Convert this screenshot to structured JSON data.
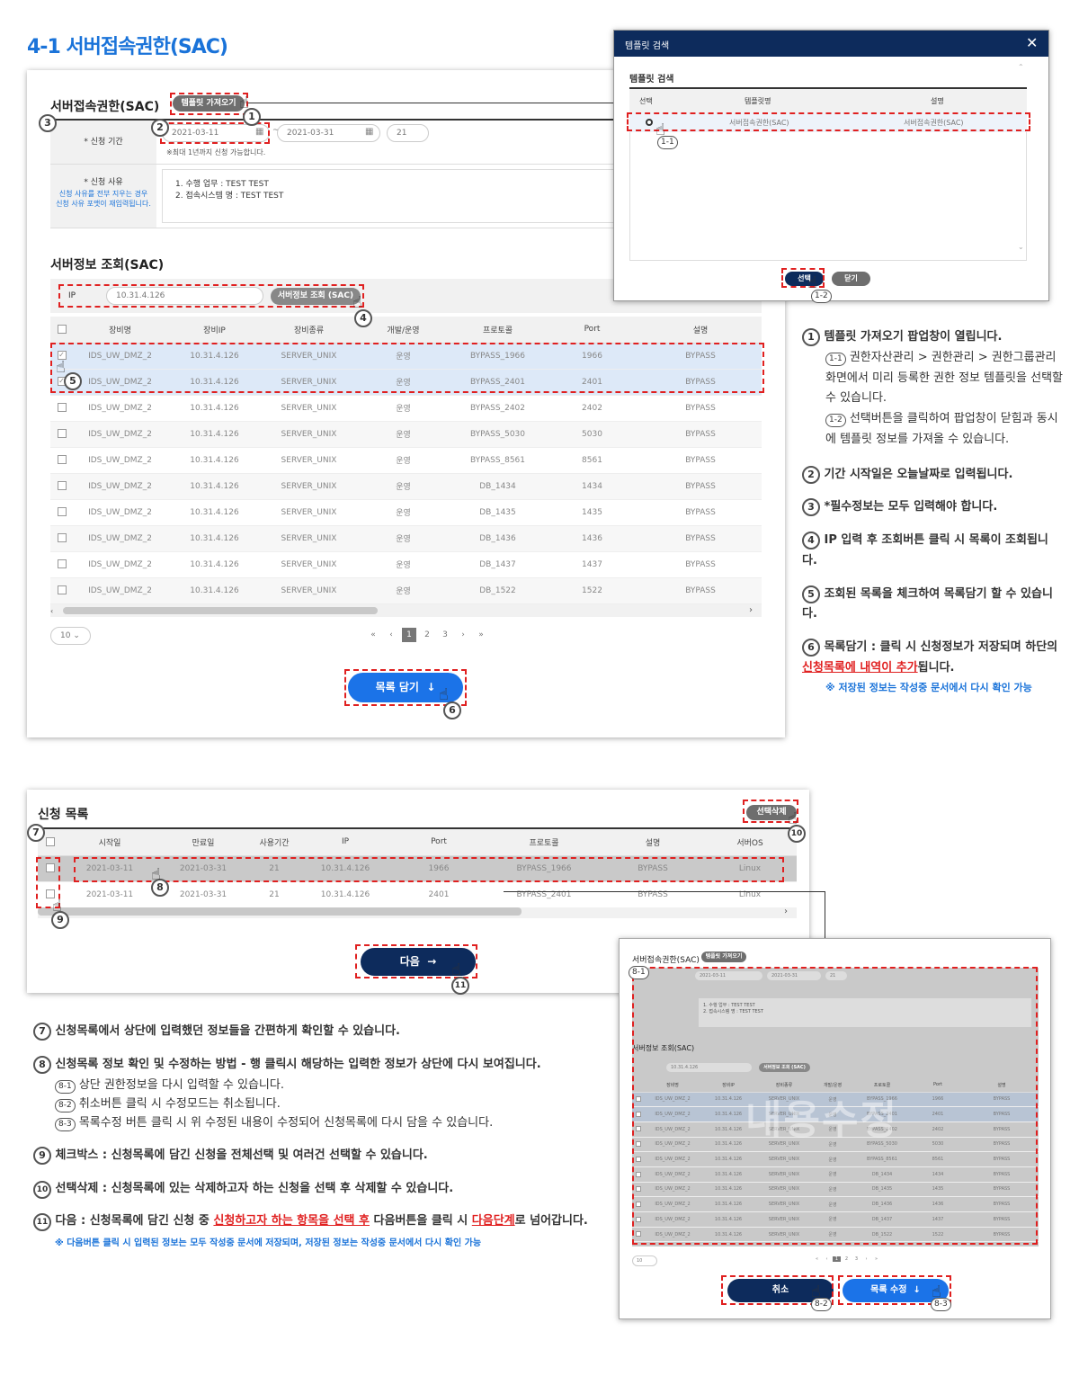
{
  "title": "4-1 서버접속권한(SAC)",
  "form": {
    "section_title": "서버접속권한(SAC)",
    "template_btn": "템플릿 가져오기",
    "period_label": "* 신청 기간",
    "start_date": "2021-03-11",
    "end_date": "2021-03-31",
    "days": "21",
    "period_note": "※최대 1년까지 신청 가능합니다.",
    "reason_label": "* 신청 사유",
    "reason_note": "신청 사유를 전부 지우는 경우 신청 사유 포맷이 재입력됩니다.",
    "reason_line1": "1. 수행 업무 : TEST TEST",
    "reason_line2": "2. 접속시스템 명 : TEST TEST",
    "tilde": "~"
  },
  "server": {
    "section_title": "서버정보 조회(SAC)",
    "ip_label": "IP",
    "ip_value": "10.31.4.126",
    "search_btn": "서버정보 조회 (SAC)",
    "columns": [
      "장비명",
      "장비IP",
      "장비종류",
      "개발/운영",
      "프로토콜",
      "Port",
      "설명"
    ],
    "rows": [
      {
        "name": "IDS_UW_DMZ_2",
        "ip": "10.31.4.126",
        "type": "SERVER_UNIX",
        "env": "운영",
        "proto": "BYPASS_1966",
        "port": "1966",
        "desc": "BYPASS"
      },
      {
        "name": "IDS_UW_DMZ_2",
        "ip": "10.31.4.126",
        "type": "SERVER_UNIX",
        "env": "운영",
        "proto": "BYPASS_2401",
        "port": "2401",
        "desc": "BYPASS"
      },
      {
        "name": "IDS_UW_DMZ_2",
        "ip": "10.31.4.126",
        "type": "SERVER_UNIX",
        "env": "운영",
        "proto": "BYPASS_2402",
        "port": "2402",
        "desc": "BYPASS"
      },
      {
        "name": "IDS_UW_DMZ_2",
        "ip": "10.31.4.126",
        "type": "SERVER_UNIX",
        "env": "운영",
        "proto": "BYPASS_5030",
        "port": "5030",
        "desc": "BYPASS"
      },
      {
        "name": "IDS_UW_DMZ_2",
        "ip": "10.31.4.126",
        "type": "SERVER_UNIX",
        "env": "운영",
        "proto": "BYPASS_8561",
        "port": "8561",
        "desc": "BYPASS"
      },
      {
        "name": "IDS_UW_DMZ_2",
        "ip": "10.31.4.126",
        "type": "SERVER_UNIX",
        "env": "운영",
        "proto": "DB_1434",
        "port": "1434",
        "desc": "BYPASS"
      },
      {
        "name": "IDS_UW_DMZ_2",
        "ip": "10.31.4.126",
        "type": "SERVER_UNIX",
        "env": "운영",
        "proto": "DB_1435",
        "port": "1435",
        "desc": "BYPASS"
      },
      {
        "name": "IDS_UW_DMZ_2",
        "ip": "10.31.4.126",
        "type": "SERVER_UNIX",
        "env": "운영",
        "proto": "DB_1436",
        "port": "1436",
        "desc": "BYPASS"
      },
      {
        "name": "IDS_UW_DMZ_2",
        "ip": "10.31.4.126",
        "type": "SERVER_UNIX",
        "env": "운영",
        "proto": "DB_1437",
        "port": "1437",
        "desc": "BYPASS"
      },
      {
        "name": "IDS_UW_DMZ_2",
        "ip": "10.31.4.126",
        "type": "SERVER_UNIX",
        "env": "운영",
        "proto": "DB_1522",
        "port": "1522",
        "desc": "BYPASS"
      }
    ],
    "page_size": "10",
    "pages": [
      "«",
      "‹",
      "1",
      "2",
      "3",
      "›",
      "»"
    ],
    "add_btn": "목록 담기"
  },
  "popup": {
    "title": "템플릿 검색",
    "close": "✕",
    "subtitle": "템플릿 검색",
    "columns": [
      "선택",
      "템플릿명",
      "설명"
    ],
    "row": {
      "name": "서버접속권한(SAC)",
      "desc": "서버접속권한(SAC)"
    },
    "select_btn": "선택",
    "close_btn": "닫기"
  },
  "notes": [
    {
      "n": "1",
      "text": "템플릿 가져오기 팝업창이 열립니다."
    },
    {
      "n": "1-1",
      "text": "권한자산관리 > 권한관리 > 권한그룹관리 화면에서 미리 등록한 권한 정보 템플릿을 선택할 수 있습니다."
    },
    {
      "n": "1-2",
      "text": "선택버튼을 클릭하여 팝업창이 닫힘과 동시에 템플릿 정보를 가져올 수 있습니다."
    },
    {
      "n": "2",
      "text": "기간 시작일은 오늘날짜로 입력됩니다."
    },
    {
      "n": "3",
      "text": "*필수정보는 모두 입력해야 합니다."
    },
    {
      "n": "4",
      "text": "IP 입력 후 조회버튼 클릭 시 목록이 조회됩니다."
    },
    {
      "n": "5",
      "text": "조회된 목록을 체크하여 목록담기 할 수 있습니다."
    },
    {
      "n": "6",
      "text_a": "목록담기 : 클릭 시 신청정보가 저장되며 하단의 ",
      "text_red": "신청목록에 내역이 추가",
      "text_b": "됩니다.",
      "sub": "※ 저장된 정보는 작성중 문서에서 다시 확인 가능"
    }
  ],
  "apply": {
    "title": "신청 목록",
    "delete_btn": "선택삭제",
    "columns": [
      "시작일",
      "만료일",
      "사용기간",
      "IP",
      "Port",
      "프로토콜",
      "설명",
      "서버OS"
    ],
    "rows": [
      {
        "start": "2021-03-11",
        "end": "2021-03-31",
        "days": "21",
        "ip": "10.31.4.126",
        "port": "1966",
        "proto": "BYPASS_1966",
        "desc": "BYPASS",
        "os": "Linux"
      },
      {
        "start": "2021-03-11",
        "end": "2021-03-31",
        "days": "21",
        "ip": "10.31.4.126",
        "port": "2401",
        "proto": "BYPASS_2401",
        "desc": "BYPASS",
        "os": "Linux"
      }
    ],
    "next_btn": "다음"
  },
  "notes2": [
    {
      "n": "7",
      "text": "신청목록에서 상단에 입력했던 정보들을 간편하게 확인할 수 있습니다."
    },
    {
      "n": "8",
      "text": "신청목록 정보 확인 및 수정하는 방법 - 행 클릭시 해당하는 입력한 정보가 상단에 다시 보여집니다."
    },
    {
      "n": "8-1",
      "text": "상단 권한정보을 다시 입력할 수 있습니다."
    },
    {
      "n": "8-2",
      "text": "취소버튼 클릭 시 수정모드는 취소됩니다."
    },
    {
      "n": "8-3",
      "text": "목록수정 버튼 클릭 시 위 수정된 내용이 수정되어 신청목록에 다시 담을 수 있습니다."
    },
    {
      "n": "9",
      "text": "체크박스 : 신청목록에 담긴 신청을 전체선택 및 여러건 선택할 수 있습니다."
    },
    {
      "n": "10",
      "text": "선택삭제 : 신청목록에 있는 삭제하고자 하는 신청을 선택 후 삭제할 수 있습니다."
    },
    {
      "n": "11",
      "text_a": "다음 : 신청목록에 담긴 신청 중 ",
      "text_red1": "신청하고자 하는 항목을 선택 후",
      "text_b": " 다음버튼을 클릭 시 ",
      "text_red2": "다음단계",
      "text_c": "로 넘어갑니다.",
      "sub": "※ 다음버튼 클릭 시 입력된 정보는 모두 작성중 문서에 저장되며, 저장된 정보는 작성중 문서에서 다시 확인 가능"
    }
  ],
  "edit": {
    "section_title": "서버접속권한(SAC)",
    "template_btn": "템플릿 가져오기",
    "server_title": "서버정보 조회(SAC)",
    "watermark": "내용수정",
    "cancel_btn": "취소",
    "update_btn": "목록 수정"
  }
}
